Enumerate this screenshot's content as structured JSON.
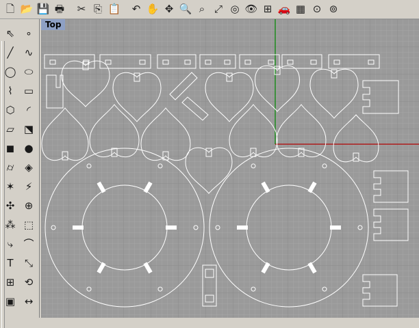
{
  "viewport": {
    "label": "Top"
  },
  "toolbar": [
    {
      "name": "new-file-icon",
      "glyph": "🗋"
    },
    {
      "name": "open-file-icon",
      "glyph": "📂"
    },
    {
      "name": "save-icon",
      "glyph": "💾"
    },
    {
      "name": "print-icon",
      "glyph": "🖶"
    },
    {
      "name": "sep"
    },
    {
      "name": "cut-icon",
      "glyph": "✂"
    },
    {
      "name": "copy-icon",
      "glyph": "⎘"
    },
    {
      "name": "paste-icon",
      "glyph": "📋"
    },
    {
      "name": "sep"
    },
    {
      "name": "undo-icon",
      "glyph": "↶"
    },
    {
      "name": "pan-hand-icon",
      "glyph": "✋"
    },
    {
      "name": "rotate-view-icon",
      "glyph": "✥"
    },
    {
      "name": "zoom-icon",
      "glyph": "🔍"
    },
    {
      "name": "zoom-window-icon",
      "glyph": "⌕"
    },
    {
      "name": "zoom-extents-icon",
      "glyph": "⤢"
    },
    {
      "name": "zoom-selected-icon",
      "glyph": "◎"
    },
    {
      "name": "named-views-icon",
      "glyph": "👁"
    },
    {
      "name": "four-viewports-icon",
      "glyph": "⊞"
    },
    {
      "name": "render-car-icon",
      "glyph": "🚗"
    },
    {
      "name": "render-preview-icon",
      "glyph": "▦"
    },
    {
      "name": "osnap-icon",
      "glyph": "⊙"
    },
    {
      "name": "properties-icon",
      "glyph": "⊚"
    }
  ],
  "sidebar_left": [
    "select-arrow-icon",
    "line-icon",
    "circle-icon",
    "polyline-icon",
    "polygon-icon",
    "surface-icon",
    "box-solid-icon",
    "cylinder-icon",
    "explode-icon",
    "move-icon",
    "array-icon",
    "bend-icon",
    "text-icon",
    "grid-array-icon",
    "blocks-icon"
  ],
  "sidebar_right": [
    "point-icon",
    "curve-icon",
    "ellipse-icon",
    "rectangle-icon",
    "arc-icon",
    "sweep-icon",
    "sphere-icon",
    "planar-surface-icon",
    "boolean-icon",
    "gumball-icon",
    "extrude-icon",
    "fillet-icon",
    "scale-icon",
    "transform-icon",
    "dimension-icon"
  ],
  "sidebar_glyphs": {
    "select-arrow-icon": "⇖",
    "line-icon": "╱",
    "circle-icon": "◯",
    "polyline-icon": "⌇",
    "polygon-icon": "⬡",
    "surface-icon": "▱",
    "box-solid-icon": "◼",
    "cylinder-icon": "⌭",
    "explode-icon": "✶",
    "move-icon": "✣",
    "array-icon": "⁂",
    "bend-icon": "⤷",
    "text-icon": "T",
    "grid-array-icon": "⊞",
    "blocks-icon": "▣",
    "point-icon": "∘",
    "curve-icon": "∿",
    "ellipse-icon": "⬭",
    "rectangle-icon": "▭",
    "arc-icon": "◜",
    "sweep-icon": "⬔",
    "sphere-icon": "●",
    "planar-surface-icon": "◈",
    "boolean-icon": "⚡",
    "gumball-icon": "⊕",
    "extrude-icon": "⬚",
    "fillet-icon": "⌒",
    "scale-icon": "⤡",
    "transform-icon": "⟲",
    "dimension-icon": "↔"
  },
  "colors": {
    "grid_bg": "#9a9a9a",
    "grid_minor": "#a6a6a6",
    "grid_major": "#8a8a8a",
    "x_axis": "#b00000",
    "y_axis": "#008a00",
    "curves": "#ffffff",
    "label_bg": "#8ea0c4"
  }
}
